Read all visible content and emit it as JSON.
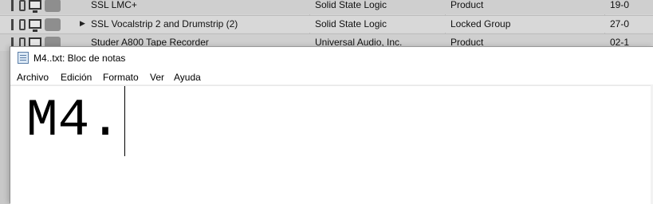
{
  "background_list": {
    "rows": [
      {
        "name": "SSL LMC+",
        "vendor": "Solid State Logic",
        "type": "Product",
        "date": "19-0",
        "expander": ""
      },
      {
        "name": "SSL Vocalstrip 2 and Drumstrip (2)",
        "vendor": "Solid State Logic",
        "type": "Locked Group",
        "date": "27-0",
        "expander": "▶"
      },
      {
        "name": "Studer A800 Tape Recorder",
        "vendor": "Universal Audio, Inc.",
        "type": "Product",
        "date": "02-1",
        "expander": ""
      }
    ]
  },
  "notepad": {
    "title": "M4..txt: Bloc de notas",
    "menu": [
      "Archivo",
      "Edición",
      "Formato",
      "Ver",
      "Ayuda"
    ],
    "content": "M4."
  }
}
